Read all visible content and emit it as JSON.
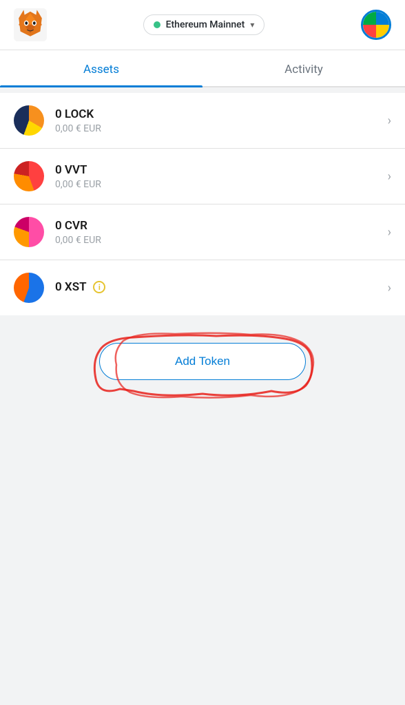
{
  "header": {
    "network_label": "Ethereum Mainnet",
    "network_dot_color": "#37c287"
  },
  "tabs": [
    {
      "id": "assets",
      "label": "Assets",
      "active": true
    },
    {
      "id": "activity",
      "label": "Activity",
      "active": false
    }
  ],
  "tokens": [
    {
      "id": "lock",
      "name": "0 LOCK",
      "value": "0,00 € EUR",
      "icon_class": "lock-icon",
      "has_info": false
    },
    {
      "id": "vvt",
      "name": "0 VVT",
      "value": "0,00 € EUR",
      "icon_class": "vvt-icon",
      "has_info": false
    },
    {
      "id": "cvr",
      "name": "0 CVR",
      "value": "0,00 € EUR",
      "icon_class": "cvr-icon",
      "has_info": false
    },
    {
      "id": "xst",
      "name": "0 XST",
      "value": "",
      "icon_class": "xst-icon",
      "has_info": true
    }
  ],
  "add_token": {
    "label": "Add Token"
  },
  "chevron": "›",
  "info_label": "i"
}
